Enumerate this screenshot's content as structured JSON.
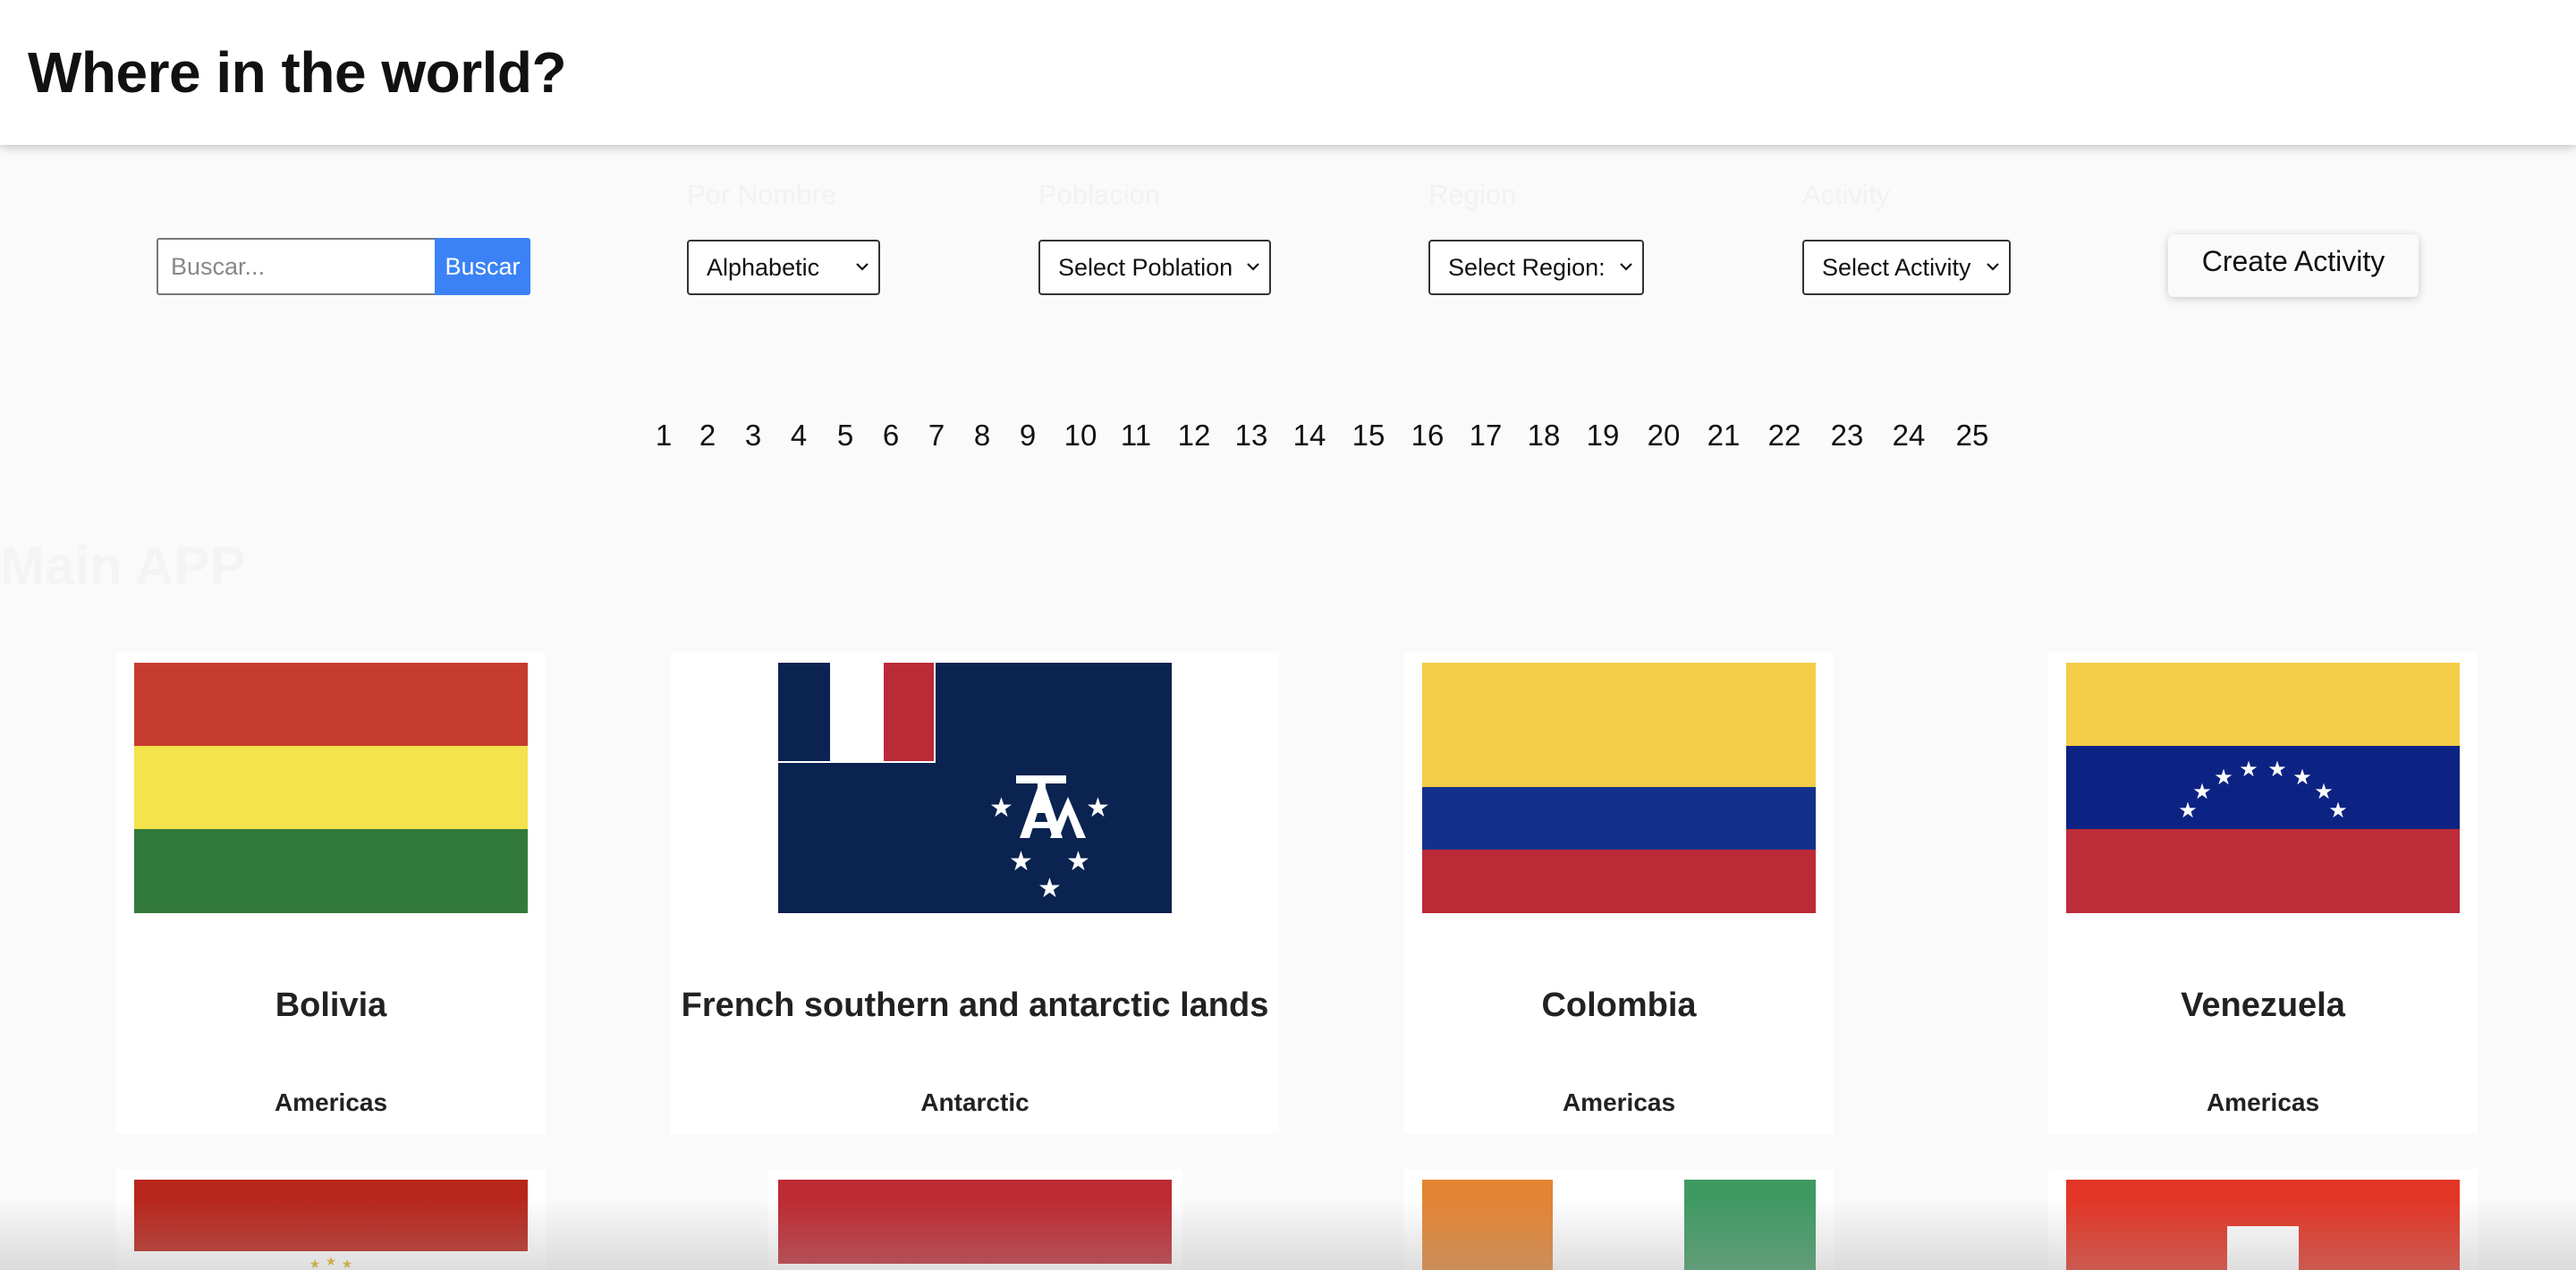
{
  "header": {
    "title": "Where in the world?"
  },
  "search": {
    "placeholder": "Buscar...",
    "button_label": "Buscar"
  },
  "filters": [
    {
      "label": "Por Nombre",
      "selected": "Alphabetic"
    },
    {
      "label": "Poblacion",
      "selected": "Select Poblation"
    },
    {
      "label": "Region",
      "selected": "Select Region:"
    },
    {
      "label": "Activity",
      "selected": "Select Activity"
    }
  ],
  "create_button": "Create Activity",
  "pagination": [
    "1",
    "2",
    "3",
    "4",
    "5",
    "6",
    "7",
    "8",
    "9",
    "10",
    "11",
    "12",
    "13",
    "14",
    "15",
    "16",
    "17",
    "18",
    "19",
    "20",
    "21",
    "22",
    "23",
    "24",
    "25"
  ],
  "main_title": "Main APP",
  "countries": [
    {
      "name": "Bolivia",
      "region": "Americas"
    },
    {
      "name": "French southern and antarctic lands",
      "region": "Antarctic"
    },
    {
      "name": "Colombia",
      "region": "Americas"
    },
    {
      "name": "Venezuela",
      "region": "Americas"
    }
  ],
  "colors": {
    "accent_blue": "#3b82f6",
    "bolivia": [
      "#c63d2f",
      "#f4e34c",
      "#327a3b"
    ],
    "colombia": [
      "#f4cd47",
      "#13318b",
      "#bb2a37"
    ],
    "venezuela": [
      "#f4cd47",
      "#0d2384",
      "#bd2c39"
    ],
    "taaf_navy": "#0a2350"
  }
}
